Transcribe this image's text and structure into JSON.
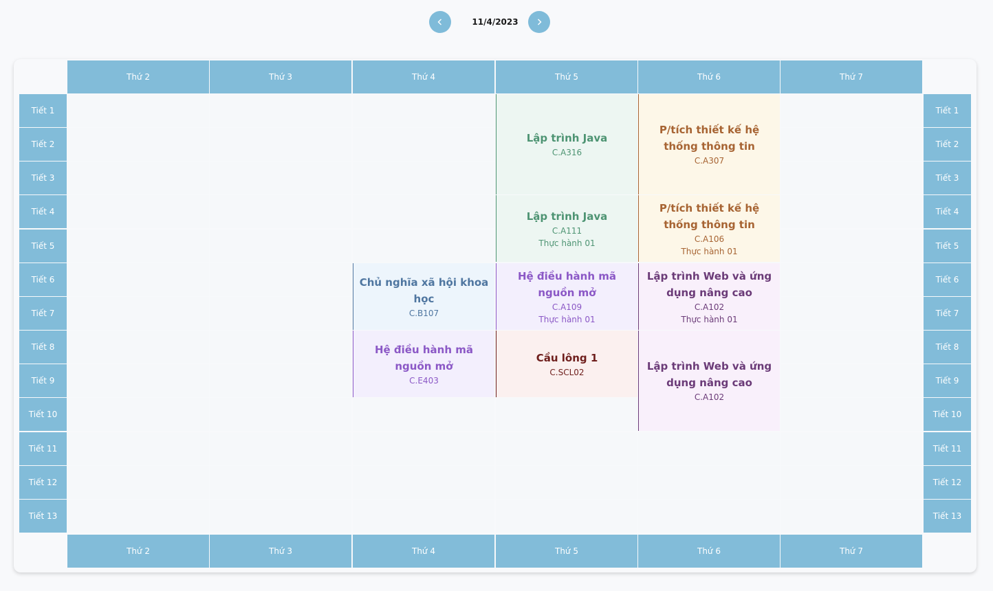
{
  "nav": {
    "date": "11/4/2023",
    "prev_icon": "chevron-left-icon",
    "next_icon": "chevron-right-icon"
  },
  "days": [
    "Thứ 2",
    "Thứ 3",
    "Thứ 4",
    "Thứ 5",
    "Thứ 6",
    "Thứ 7"
  ],
  "periods": [
    "Tiết 1",
    "Tiết 2",
    "Tiết 3",
    "Tiết 4",
    "Tiết 5",
    "Tiết 6",
    "Tiết 7",
    "Tiết 8",
    "Tiết 9",
    "Tiết 10",
    "Tiết 11",
    "Tiết 12",
    "Tiết 13"
  ],
  "colors": {
    "header": "#82bcd9",
    "green": "#4e9473",
    "orange": "#a76433",
    "blue": "#4f76a0",
    "purple": "#8b58c6",
    "plum": "#6b3b78",
    "red": "#6e1e1c"
  },
  "events": [
    {
      "day": 3,
      "start": 1,
      "span": 3,
      "title": "Lập trình Java",
      "room": "C.A316",
      "note": "",
      "color": "green"
    },
    {
      "day": 4,
      "start": 1,
      "span": 3,
      "title": "P/tích thiết kế hệ thống thông tin",
      "room": "C.A307",
      "note": "",
      "color": "orange"
    },
    {
      "day": 3,
      "start": 4,
      "span": 2,
      "title": "Lập trình Java",
      "room": "C.A111",
      "note": "Thực hành 01",
      "color": "green"
    },
    {
      "day": 4,
      "start": 4,
      "span": 2,
      "title": "P/tích thiết kế hệ thống thông tin",
      "room": "C.A106",
      "note": "Thực hành 01",
      "color": "orange"
    },
    {
      "day": 2,
      "start": 6,
      "span": 2,
      "title": "Chủ nghĩa xã hội khoa học",
      "room": "C.B107",
      "note": "",
      "color": "blue"
    },
    {
      "day": 3,
      "start": 6,
      "span": 2,
      "title": "Hệ điều hành mã nguồn mở",
      "room": "C.A109",
      "note": "Thực hành 01",
      "color": "purple"
    },
    {
      "day": 4,
      "start": 6,
      "span": 2,
      "title": "Lập trình Web và ứng dụng nâng cao",
      "room": "C.A102",
      "note": "Thực hành 01",
      "color": "plum"
    },
    {
      "day": 2,
      "start": 8,
      "span": 2,
      "title": "Hệ điều hành mã nguồn mở",
      "room": "C.E403",
      "note": "",
      "color": "purple"
    },
    {
      "day": 3,
      "start": 8,
      "span": 2,
      "title": "Cầu lông 1",
      "room": "C.SCL02",
      "note": "",
      "color": "red"
    },
    {
      "day": 4,
      "start": 8,
      "span": 3,
      "title": "Lập trình Web và ứng dụng nâng cao",
      "room": "C.A102",
      "note": "",
      "color": "plum"
    }
  ]
}
